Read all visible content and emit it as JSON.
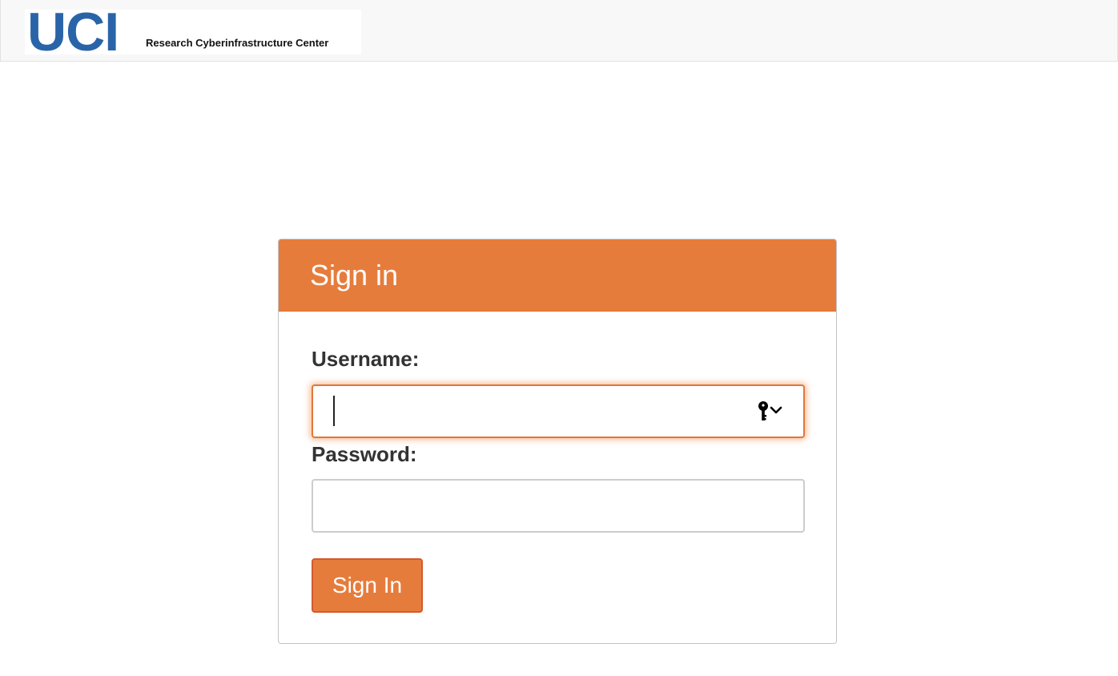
{
  "header": {
    "logo_text": "UCI",
    "logo_subtitle": "Research Cyberinfrastructure Center"
  },
  "login": {
    "title": "Sign in",
    "username_label": "Username:",
    "username_value": "",
    "password_label": "Password:",
    "password_value": "",
    "submit_label": "Sign In",
    "autofill_icon": "key-icon"
  },
  "colors": {
    "accent": "#e67c3c",
    "brand_blue": "#2a64a8",
    "focus_border": "#e0773a"
  }
}
